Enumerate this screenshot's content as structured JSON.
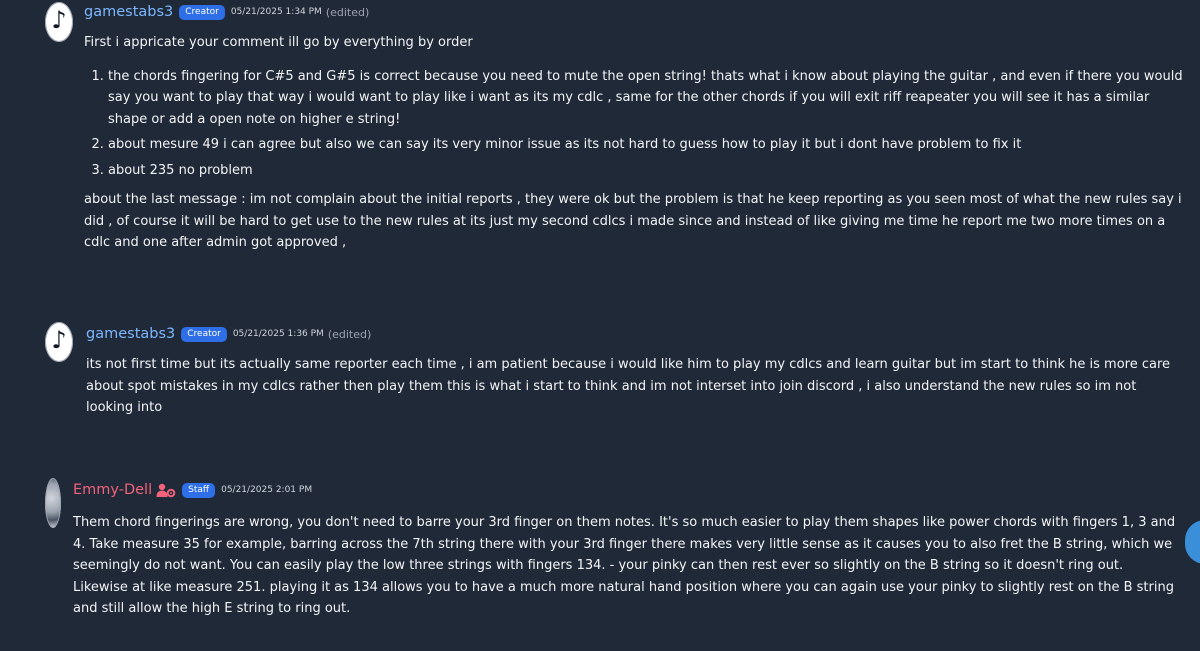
{
  "messages": [
    {
      "avatar_icon": "music-note-icon",
      "username": "gamestabs3",
      "badge": "Creator",
      "time": "05/21/2025 1:34 PM",
      "edited": "(edited)",
      "intro": "First i appricate your comment ill go by everything by order",
      "list": [
        "the chords fingering for C#5 and G#5 is correct because you need to mute the open string! thats what i know about playing the guitar , and even if there you would say you want to play that way i would want to play like i want as its my cdlc , same for the other chords if you will exit riff reapeater you will see it has a similar shape or add a open note on higher e string!",
        "about mesure 49 i can agree but also we can say its very minor issue as its not hard to guess how to play it but i dont have problem to fix it",
        "about 235 no problem"
      ],
      "outro": "about the last message : im not complain about the initial reports , they were ok but the problem is that he keep reporting as you seen most of what the new rules say i did , of course it will be hard to get use to the new rules at its just my second cdlcs i made since and instead of like giving me time he report me two more times on a cdlc and one after admin got approved ,"
    },
    {
      "avatar_icon": "music-note-icon",
      "username": "gamestabs3",
      "badge": "Creator",
      "time": "05/21/2025 1:36 PM",
      "edited": "(edited)",
      "text": "its not first time but its actually same reporter each time , i am patient because i would like him to play my cdlcs and learn guitar but im start to think he is more care about spot mistakes in my cdlcs rather then play them this is what i start to think and im not interset into join discord , i also understand the new rules so im not looking into"
    },
    {
      "avatar_icon": "disc-avatar",
      "username": "Emmy-Dell",
      "role_icon": "user-gear-icon",
      "badge": "Staff",
      "time": "05/21/2025 2:01 PM",
      "text": "Them chord fingerings are wrong, you don't need to barre your 3rd finger on them notes. It's so much easier to play them shapes like power chords with fingers 1, 3 and 4. Take measure 35 for example, barring across the 7th string there with your 3rd finger there makes very little sense as it causes you to also fret the B string, which we seemingly do not want. You can easily play the low three strings with fingers 134. - your pinky can then rest ever so slightly on the B string so it doesn't ring out. Likewise at like measure 251. playing it as 134 allows you to have a much more natural hand position where you can again use your pinky to slightly rest on the B string and still allow the high E string to ring out."
    }
  ],
  "colors": {
    "background": "#1f2937",
    "username_creator": "#7cb7ff",
    "username_staff": "#f2627a",
    "badge": "#2e6ee6"
  }
}
